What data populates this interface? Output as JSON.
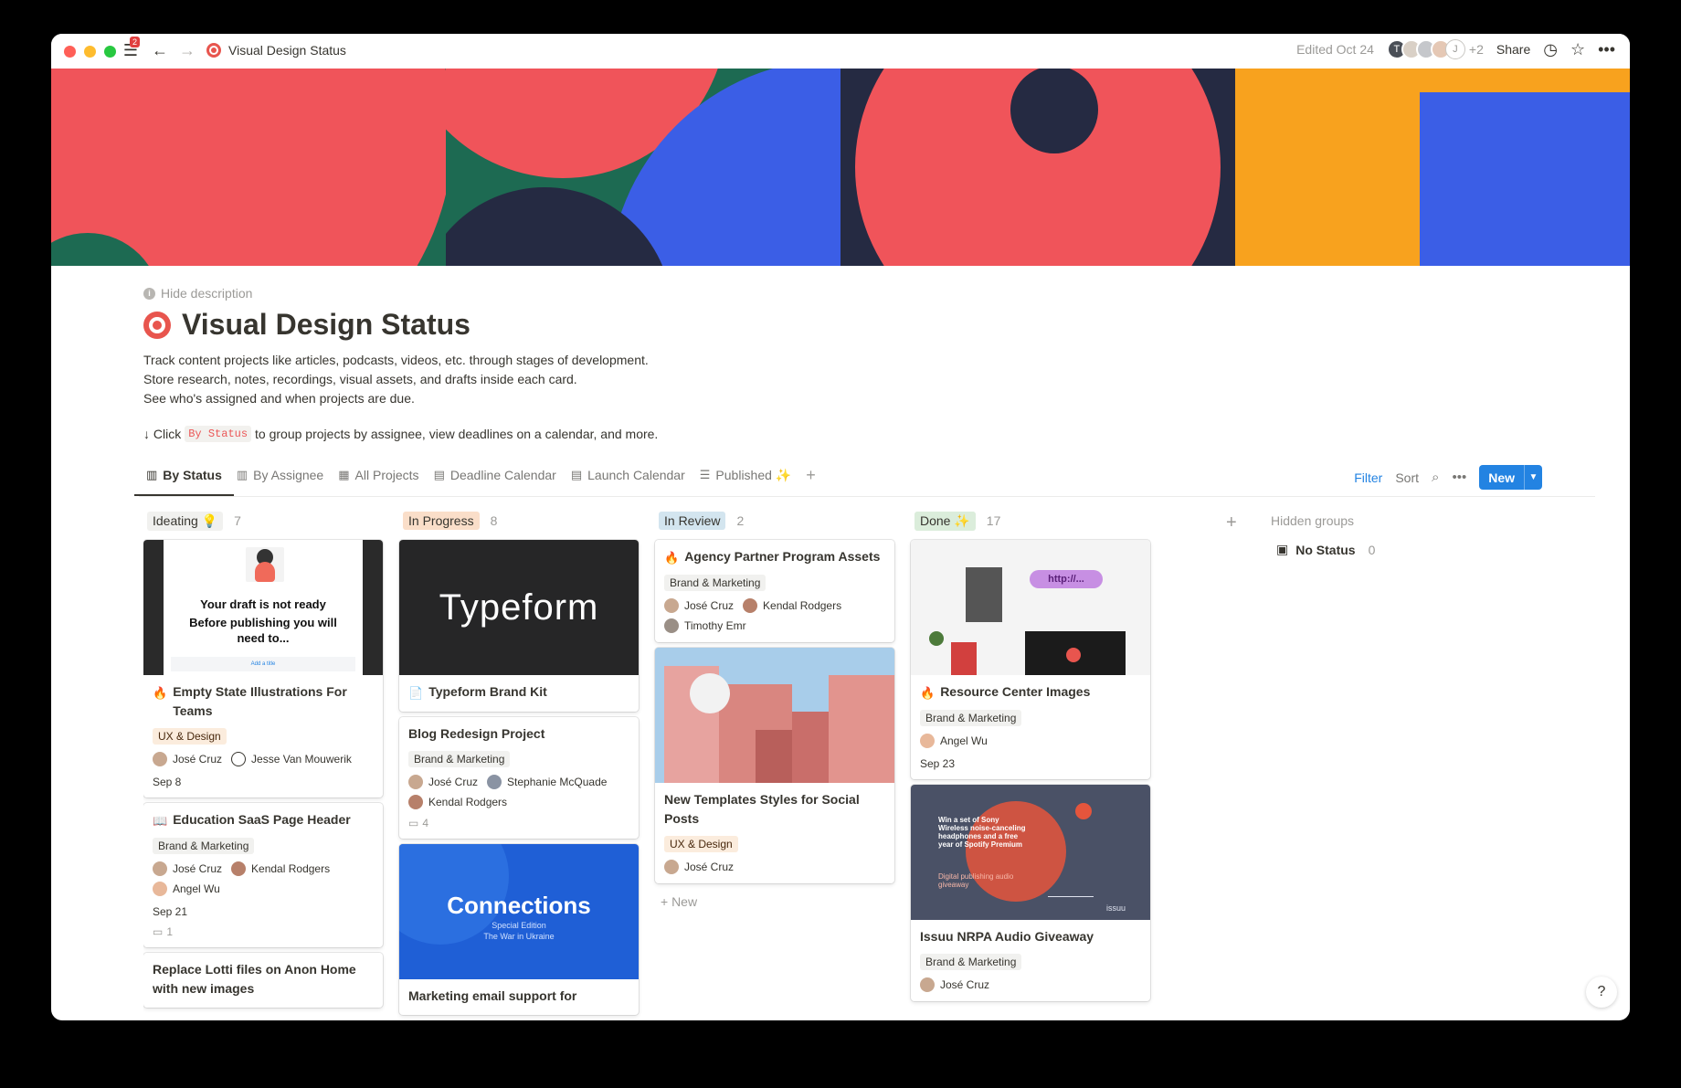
{
  "titlebar": {
    "menu_badge": "2",
    "page_title": "Visual Design Status",
    "edited": "Edited Oct 24",
    "avatar_initials": [
      "T",
      "J"
    ],
    "extra_count": "+2",
    "share": "Share"
  },
  "page": {
    "hide_description": "Hide description",
    "title": "Visual Design Status",
    "description": [
      "Track content projects like articles, podcasts, videos, etc. through stages of development.",
      "Store research, notes, recordings, visual assets, and drafts inside each card.",
      "See who's assigned and when projects are due."
    ],
    "hint_prefix": "↓ Click",
    "hint_code": "By Status",
    "hint_suffix": "to group projects by assignee, view deadlines on a calendar, and more."
  },
  "tabs": [
    {
      "label": "By Status",
      "active": true
    },
    {
      "label": "By Assignee"
    },
    {
      "label": "All Projects"
    },
    {
      "label": "Deadline Calendar"
    },
    {
      "label": "Launch Calendar"
    },
    {
      "label": "Published ✨"
    }
  ],
  "toolbar": {
    "filter": "Filter",
    "sort": "Sort",
    "new": "New"
  },
  "columns": [
    {
      "label": "Ideating 💡",
      "count": "7",
      "color": "#f1f1ef",
      "cards": [
        {
          "cover_text": [
            "Your draft is not ready",
            "Before publishing you will need to...",
            "Add a title"
          ],
          "emoji": "🔥",
          "title": "Empty State Illustrations For Teams",
          "tag": "UX & Design",
          "people": [
            "José Cruz",
            "Jesse Van Mouwerik"
          ],
          "date": "Sep 8"
        },
        {
          "emoji": "📖",
          "title": "Education SaaS Page Header",
          "tag": "Brand & Marketing",
          "people": [
            "José Cruz",
            "Kendal Rodgers",
            "Angel Wu"
          ],
          "date": "Sep 21",
          "comments": "1"
        },
        {
          "title": "Replace Lotti files on Anon Home with new images"
        }
      ]
    },
    {
      "label": "In Progress",
      "count": "8",
      "color": "#fadec9",
      "cards": [
        {
          "cover_text": "Typeform",
          "emoji": "📄",
          "title": "Typeform Brand Kit"
        },
        {
          "title": "Blog Redesign Project",
          "tag": "Brand & Marketing",
          "people": [
            "José Cruz",
            "Stephanie McQuade",
            "Kendal Rodgers"
          ],
          "comments": "4"
        },
        {
          "cover_text": [
            "Connections",
            "Special Edition",
            "The War in Ukraine"
          ],
          "title": "Marketing email support for"
        }
      ]
    },
    {
      "label": "In Review",
      "count": "2",
      "color": "#d3e5ef",
      "cards": [
        {
          "emoji": "🔥",
          "title": "Agency Partner Program Assets",
          "tag": "Brand & Marketing",
          "people": [
            "José Cruz",
            "Kendal Rodgers",
            "Timothy Emr"
          ]
        },
        {
          "title": "New Templates Styles for Social Posts",
          "tag": "UX & Design",
          "people": [
            "José Cruz"
          ]
        }
      ],
      "new_label": "+ New"
    },
    {
      "label": "Done ✨",
      "count": "17",
      "color": "#dbeddb",
      "cards": [
        {
          "cover_text": "http://...",
          "emoji": "🔥",
          "title": "Resource Center Images",
          "tag": "Brand & Marketing",
          "people": [
            "Angel Wu"
          ],
          "date": "Sep 23"
        },
        {
          "cover_text": [
            "Win a set of Sony Wireless noise-canceling headphones and a free year of Spotify Premium",
            "Digital publishing audio giveaway",
            "issuu"
          ],
          "title": "Issuu NRPA Audio Giveaway",
          "tag": "Brand & Marketing",
          "people": [
            "José Cruz"
          ]
        }
      ]
    }
  ],
  "hidden_groups": {
    "title": "Hidden groups",
    "items": [
      {
        "label": "No Status",
        "count": "0"
      }
    ]
  },
  "help": "?"
}
